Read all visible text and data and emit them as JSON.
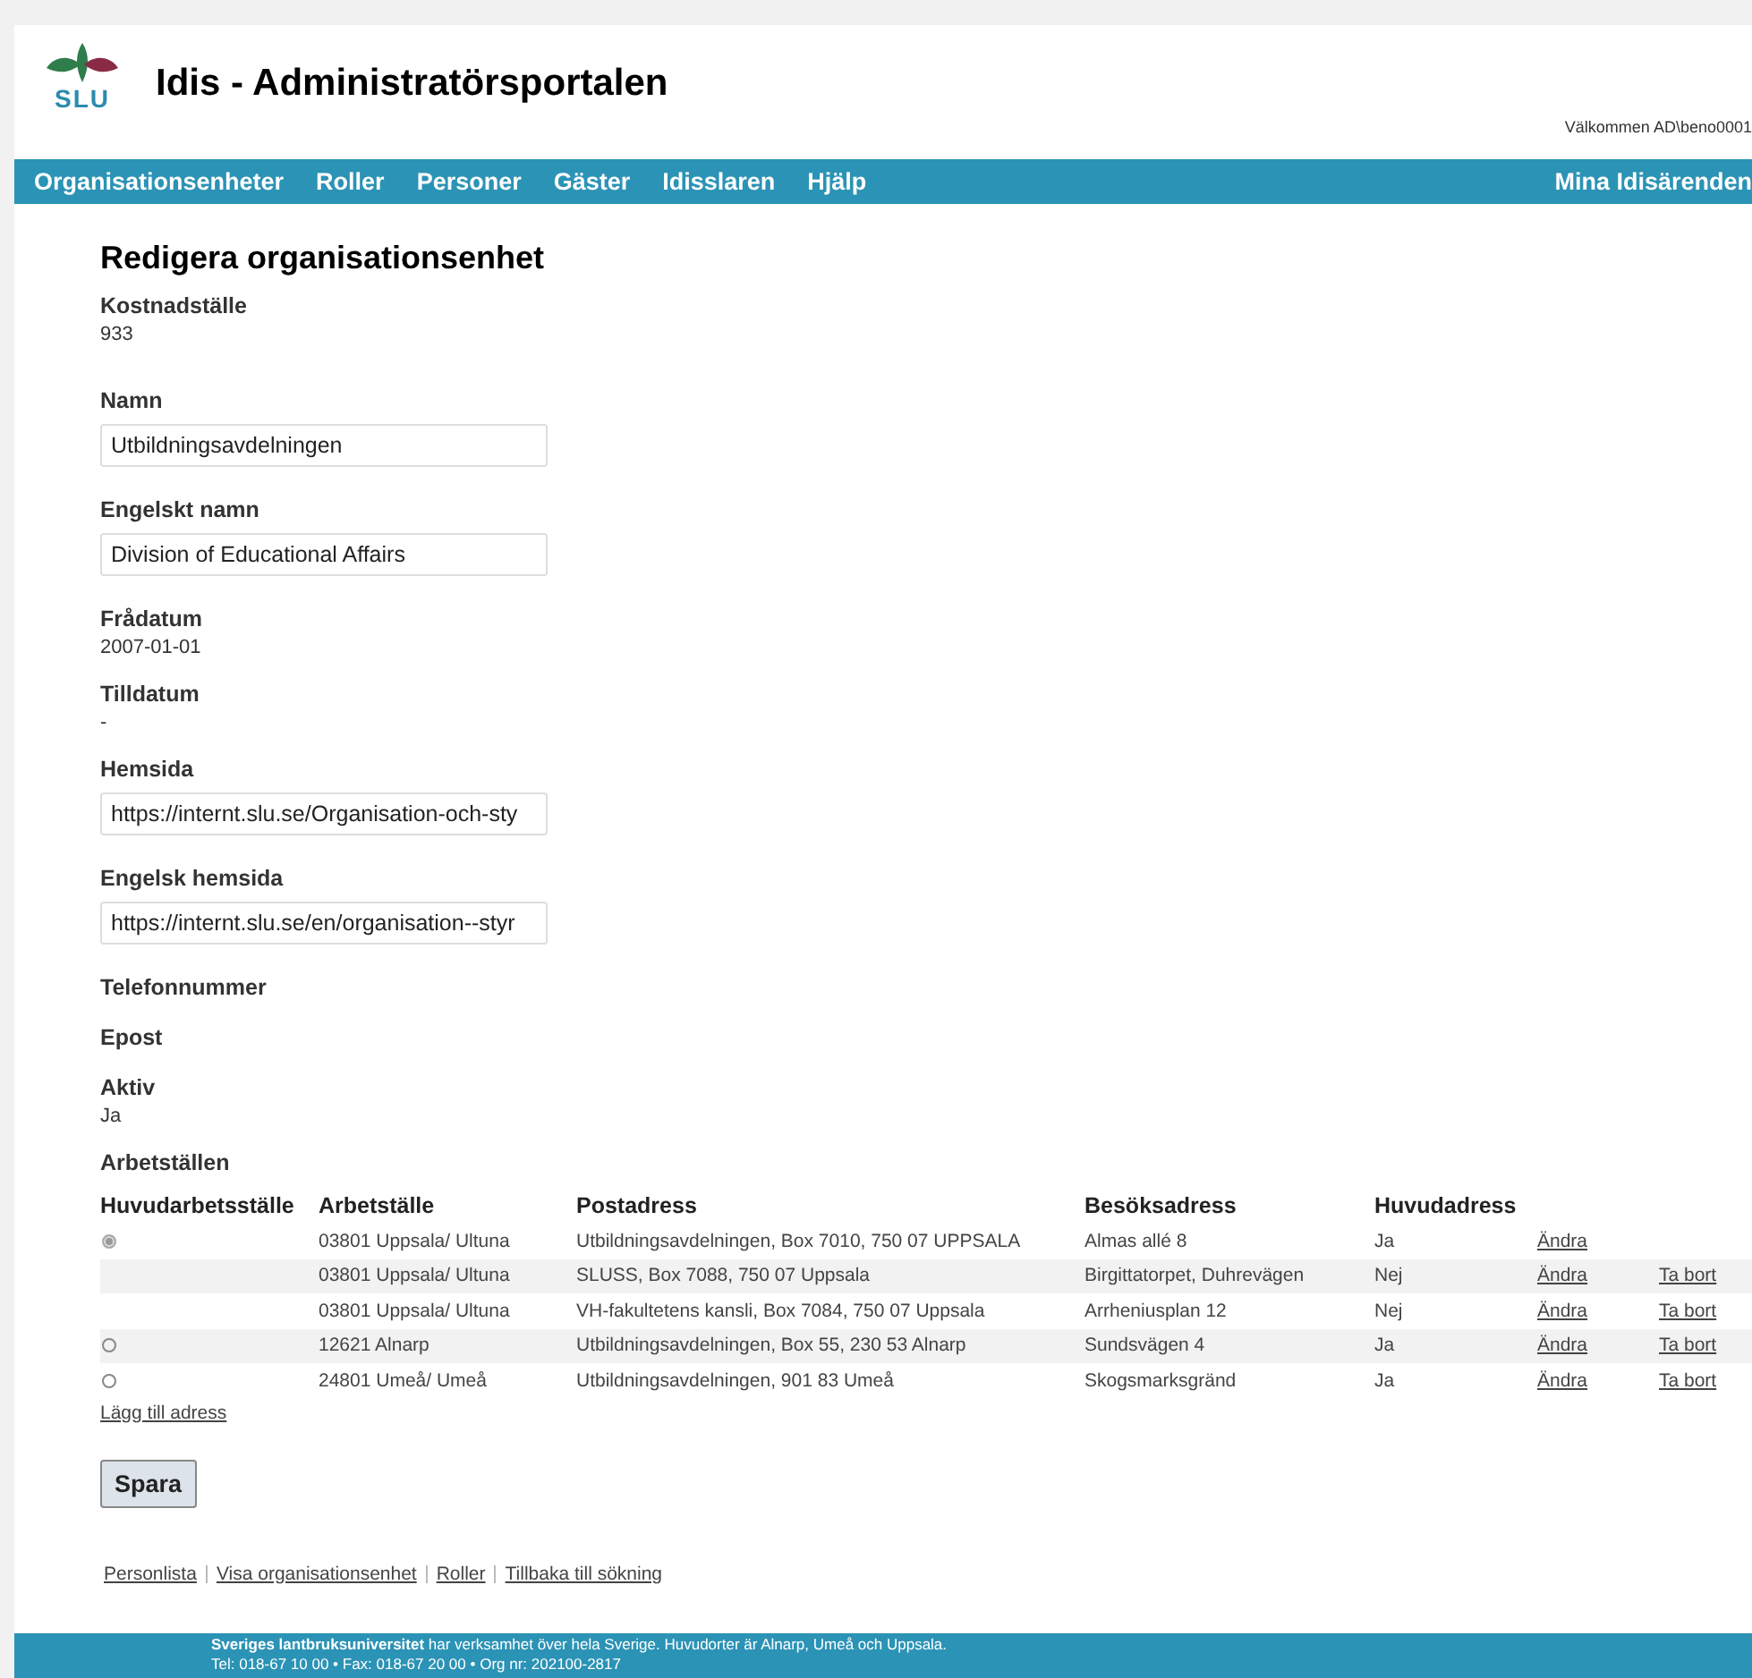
{
  "header": {
    "logo_text": "SLU",
    "title": "Idis - Administratörsportalen",
    "welcome": "Välkommen AD\\beno0001"
  },
  "nav": {
    "items": [
      {
        "label": "Organisationsenheter"
      },
      {
        "label": "Roller"
      },
      {
        "label": "Personer"
      },
      {
        "label": "Gäster"
      },
      {
        "label": "Idisslaren"
      },
      {
        "label": "Hjälp"
      }
    ],
    "right": "Mina Idisärenden"
  },
  "page_title": "Redigera organisationsenhet",
  "fields": [
    {
      "kind": "static",
      "label": "Kostnadställe",
      "value": "933"
    },
    {
      "kind": "input",
      "label": "Namn",
      "value": "Utbildningsavdelningen"
    },
    {
      "kind": "input",
      "label": "Engelskt namn",
      "value": "Division of Educational Affairs"
    },
    {
      "kind": "static",
      "label": "Frådatum",
      "value": "2007-01-01"
    },
    {
      "kind": "static",
      "label": "Tilldatum",
      "value": "-"
    },
    {
      "kind": "input",
      "label": "Hemsida",
      "value": "https://internt.slu.se/Organisation-och-sty"
    },
    {
      "kind": "input",
      "label": "Engelsk hemsida",
      "value": "https://internt.slu.se/en/organisation--styr"
    },
    {
      "kind": "empty",
      "label": "Telefonnummer"
    },
    {
      "kind": "empty",
      "label": "Epost"
    },
    {
      "kind": "static",
      "label": "Aktiv",
      "value": "Ja"
    }
  ],
  "workplaces": {
    "title": "Arbetställen",
    "columns": [
      "Huvudarbetsställe",
      "Arbetställe",
      "Postadress",
      "Besöksadress",
      "Huvudadress"
    ],
    "rows": [
      {
        "radio": {
          "selected": true
        },
        "workplace": "03801 Uppsala/ Ultuna",
        "postal": "Utbildningsavdelningen, Box 7010, 750 07 UPPSALA",
        "visit": "Almas allé 8",
        "main": "Ja",
        "edit": "Ändra"
      },
      {
        "workplace": "03801 Uppsala/ Ultuna",
        "postal": "SLUSS, Box 7088, 750 07 Uppsala",
        "visit": "Birgittatorpet, Duhrevägen",
        "main": "Nej",
        "edit": "Ändra",
        "delete": "Ta bort"
      },
      {
        "workplace": "03801 Uppsala/ Ultuna",
        "postal": "VH-fakultetens kansli, Box 7084, 750 07 Uppsala",
        "visit": "Arrheniusplan 12",
        "main": "Nej",
        "edit": "Ändra",
        "delete": "Ta bort"
      },
      {
        "radio": {
          "selected": false
        },
        "workplace": "12621 Alnarp",
        "postal": "Utbildningsavdelningen, Box 55, 230 53 Alnarp",
        "visit": "Sundsvägen 4",
        "main": "Ja",
        "edit": "Ändra",
        "delete": "Ta bort"
      },
      {
        "radio": {
          "selected": false
        },
        "workplace": "24801 Umeå/ Umeå",
        "postal": "Utbildningsavdelningen, 901 83 Umeå",
        "visit": "Skogsmarksgränd",
        "main": "Ja",
        "edit": "Ändra",
        "delete": "Ta bort"
      }
    ],
    "add_link": "Lägg till adress"
  },
  "save_button": "Spara",
  "bottom_links": [
    "Personlista",
    "Visa organisationsenhet",
    "Roller",
    "Tillbaka till sökning"
  ],
  "footer": {
    "line1": "**Sveriges lantbruksuniversitet** har verksamhet över hela Sverige. Huvudorter är Alnarp, Umeå och Uppsala.",
    "line2": "Tel: 018-67 10 00 • Fax: 018-67 20 00 • Org nr: 202100-2817"
  }
}
